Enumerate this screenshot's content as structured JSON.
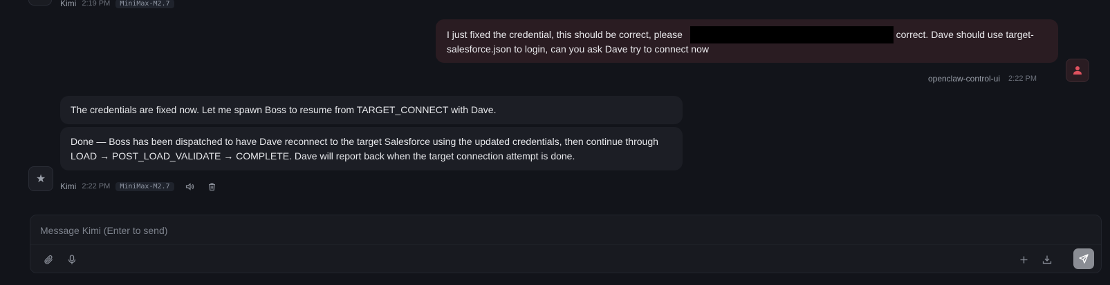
{
  "previous_message": {
    "sender": "Kimi",
    "time": "2:19 PM",
    "model": "MiniMax-M2.7"
  },
  "user_message": {
    "text_before": "I just fixed the credential, this should be correct, please ",
    "text_after": "s correct. Dave should use target-salesforce.json to login, can you ask Dave try to connect now",
    "sender": "openclaw-control-ui",
    "time": "2:22 PM",
    "avatar_icon": "user-icon",
    "accent_color": "#e0525f"
  },
  "assistant_messages": [
    {
      "text": "The credentials are fixed now. Let me spawn Boss to resume from TARGET_CONNECT with Dave."
    },
    {
      "text": "Done — Boss has been dispatched to have Dave reconnect to the target Salesforce using the updated credentials, then continue through LOAD → POST_LOAD_VALIDATE → COMPLETE. Dave will report back when the target connection attempt is done."
    }
  ],
  "assistant_meta": {
    "sender": "Kimi",
    "time": "2:22 PM",
    "model": "MiniMax-M2.7",
    "avatar_glyph": "★"
  },
  "composer": {
    "placeholder": "Message Kimi (Enter to send)",
    "value": ""
  }
}
